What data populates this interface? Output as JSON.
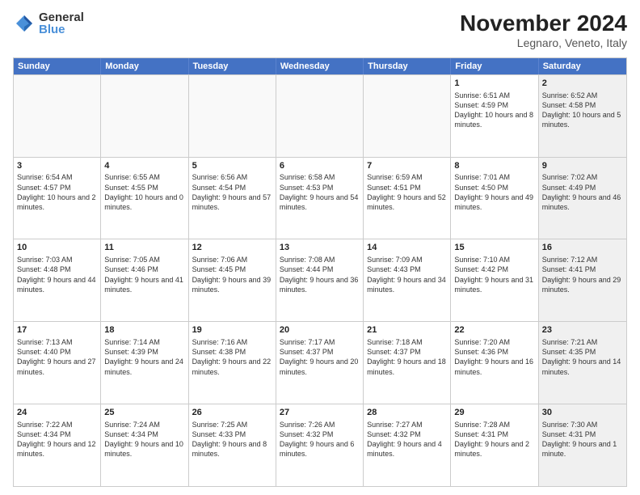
{
  "logo": {
    "general": "General",
    "blue": "Blue"
  },
  "header": {
    "month": "November 2024",
    "location": "Legnaro, Veneto, Italy"
  },
  "days": [
    "Sunday",
    "Monday",
    "Tuesday",
    "Wednesday",
    "Thursday",
    "Friday",
    "Saturday"
  ],
  "weeks": [
    [
      {
        "num": "",
        "text": "",
        "empty": true
      },
      {
        "num": "",
        "text": "",
        "empty": true
      },
      {
        "num": "",
        "text": "",
        "empty": true
      },
      {
        "num": "",
        "text": "",
        "empty": true
      },
      {
        "num": "",
        "text": "",
        "empty": true
      },
      {
        "num": "1",
        "text": "Sunrise: 6:51 AM\nSunset: 4:59 PM\nDaylight: 10 hours and 8 minutes.",
        "empty": false,
        "shaded": false
      },
      {
        "num": "2",
        "text": "Sunrise: 6:52 AM\nSunset: 4:58 PM\nDaylight: 10 hours and 5 minutes.",
        "empty": false,
        "shaded": true
      }
    ],
    [
      {
        "num": "3",
        "text": "Sunrise: 6:54 AM\nSunset: 4:57 PM\nDaylight: 10 hours and 2 minutes.",
        "empty": false,
        "shaded": false
      },
      {
        "num": "4",
        "text": "Sunrise: 6:55 AM\nSunset: 4:55 PM\nDaylight: 10 hours and 0 minutes.",
        "empty": false,
        "shaded": false
      },
      {
        "num": "5",
        "text": "Sunrise: 6:56 AM\nSunset: 4:54 PM\nDaylight: 9 hours and 57 minutes.",
        "empty": false,
        "shaded": false
      },
      {
        "num": "6",
        "text": "Sunrise: 6:58 AM\nSunset: 4:53 PM\nDaylight: 9 hours and 54 minutes.",
        "empty": false,
        "shaded": false
      },
      {
        "num": "7",
        "text": "Sunrise: 6:59 AM\nSunset: 4:51 PM\nDaylight: 9 hours and 52 minutes.",
        "empty": false,
        "shaded": false
      },
      {
        "num": "8",
        "text": "Sunrise: 7:01 AM\nSunset: 4:50 PM\nDaylight: 9 hours and 49 minutes.",
        "empty": false,
        "shaded": false
      },
      {
        "num": "9",
        "text": "Sunrise: 7:02 AM\nSunset: 4:49 PM\nDaylight: 9 hours and 46 minutes.",
        "empty": false,
        "shaded": true
      }
    ],
    [
      {
        "num": "10",
        "text": "Sunrise: 7:03 AM\nSunset: 4:48 PM\nDaylight: 9 hours and 44 minutes.",
        "empty": false,
        "shaded": false
      },
      {
        "num": "11",
        "text": "Sunrise: 7:05 AM\nSunset: 4:46 PM\nDaylight: 9 hours and 41 minutes.",
        "empty": false,
        "shaded": false
      },
      {
        "num": "12",
        "text": "Sunrise: 7:06 AM\nSunset: 4:45 PM\nDaylight: 9 hours and 39 minutes.",
        "empty": false,
        "shaded": false
      },
      {
        "num": "13",
        "text": "Sunrise: 7:08 AM\nSunset: 4:44 PM\nDaylight: 9 hours and 36 minutes.",
        "empty": false,
        "shaded": false
      },
      {
        "num": "14",
        "text": "Sunrise: 7:09 AM\nSunset: 4:43 PM\nDaylight: 9 hours and 34 minutes.",
        "empty": false,
        "shaded": false
      },
      {
        "num": "15",
        "text": "Sunrise: 7:10 AM\nSunset: 4:42 PM\nDaylight: 9 hours and 31 minutes.",
        "empty": false,
        "shaded": false
      },
      {
        "num": "16",
        "text": "Sunrise: 7:12 AM\nSunset: 4:41 PM\nDaylight: 9 hours and 29 minutes.",
        "empty": false,
        "shaded": true
      }
    ],
    [
      {
        "num": "17",
        "text": "Sunrise: 7:13 AM\nSunset: 4:40 PM\nDaylight: 9 hours and 27 minutes.",
        "empty": false,
        "shaded": false
      },
      {
        "num": "18",
        "text": "Sunrise: 7:14 AM\nSunset: 4:39 PM\nDaylight: 9 hours and 24 minutes.",
        "empty": false,
        "shaded": false
      },
      {
        "num": "19",
        "text": "Sunrise: 7:16 AM\nSunset: 4:38 PM\nDaylight: 9 hours and 22 minutes.",
        "empty": false,
        "shaded": false
      },
      {
        "num": "20",
        "text": "Sunrise: 7:17 AM\nSunset: 4:37 PM\nDaylight: 9 hours and 20 minutes.",
        "empty": false,
        "shaded": false
      },
      {
        "num": "21",
        "text": "Sunrise: 7:18 AM\nSunset: 4:37 PM\nDaylight: 9 hours and 18 minutes.",
        "empty": false,
        "shaded": false
      },
      {
        "num": "22",
        "text": "Sunrise: 7:20 AM\nSunset: 4:36 PM\nDaylight: 9 hours and 16 minutes.",
        "empty": false,
        "shaded": false
      },
      {
        "num": "23",
        "text": "Sunrise: 7:21 AM\nSunset: 4:35 PM\nDaylight: 9 hours and 14 minutes.",
        "empty": false,
        "shaded": true
      }
    ],
    [
      {
        "num": "24",
        "text": "Sunrise: 7:22 AM\nSunset: 4:34 PM\nDaylight: 9 hours and 12 minutes.",
        "empty": false,
        "shaded": false
      },
      {
        "num": "25",
        "text": "Sunrise: 7:24 AM\nSunset: 4:34 PM\nDaylight: 9 hours and 10 minutes.",
        "empty": false,
        "shaded": false
      },
      {
        "num": "26",
        "text": "Sunrise: 7:25 AM\nSunset: 4:33 PM\nDaylight: 9 hours and 8 minutes.",
        "empty": false,
        "shaded": false
      },
      {
        "num": "27",
        "text": "Sunrise: 7:26 AM\nSunset: 4:32 PM\nDaylight: 9 hours and 6 minutes.",
        "empty": false,
        "shaded": false
      },
      {
        "num": "28",
        "text": "Sunrise: 7:27 AM\nSunset: 4:32 PM\nDaylight: 9 hours and 4 minutes.",
        "empty": false,
        "shaded": false
      },
      {
        "num": "29",
        "text": "Sunrise: 7:28 AM\nSunset: 4:31 PM\nDaylight: 9 hours and 2 minutes.",
        "empty": false,
        "shaded": false
      },
      {
        "num": "30",
        "text": "Sunrise: 7:30 AM\nSunset: 4:31 PM\nDaylight: 9 hours and 1 minute.",
        "empty": false,
        "shaded": true
      }
    ]
  ]
}
